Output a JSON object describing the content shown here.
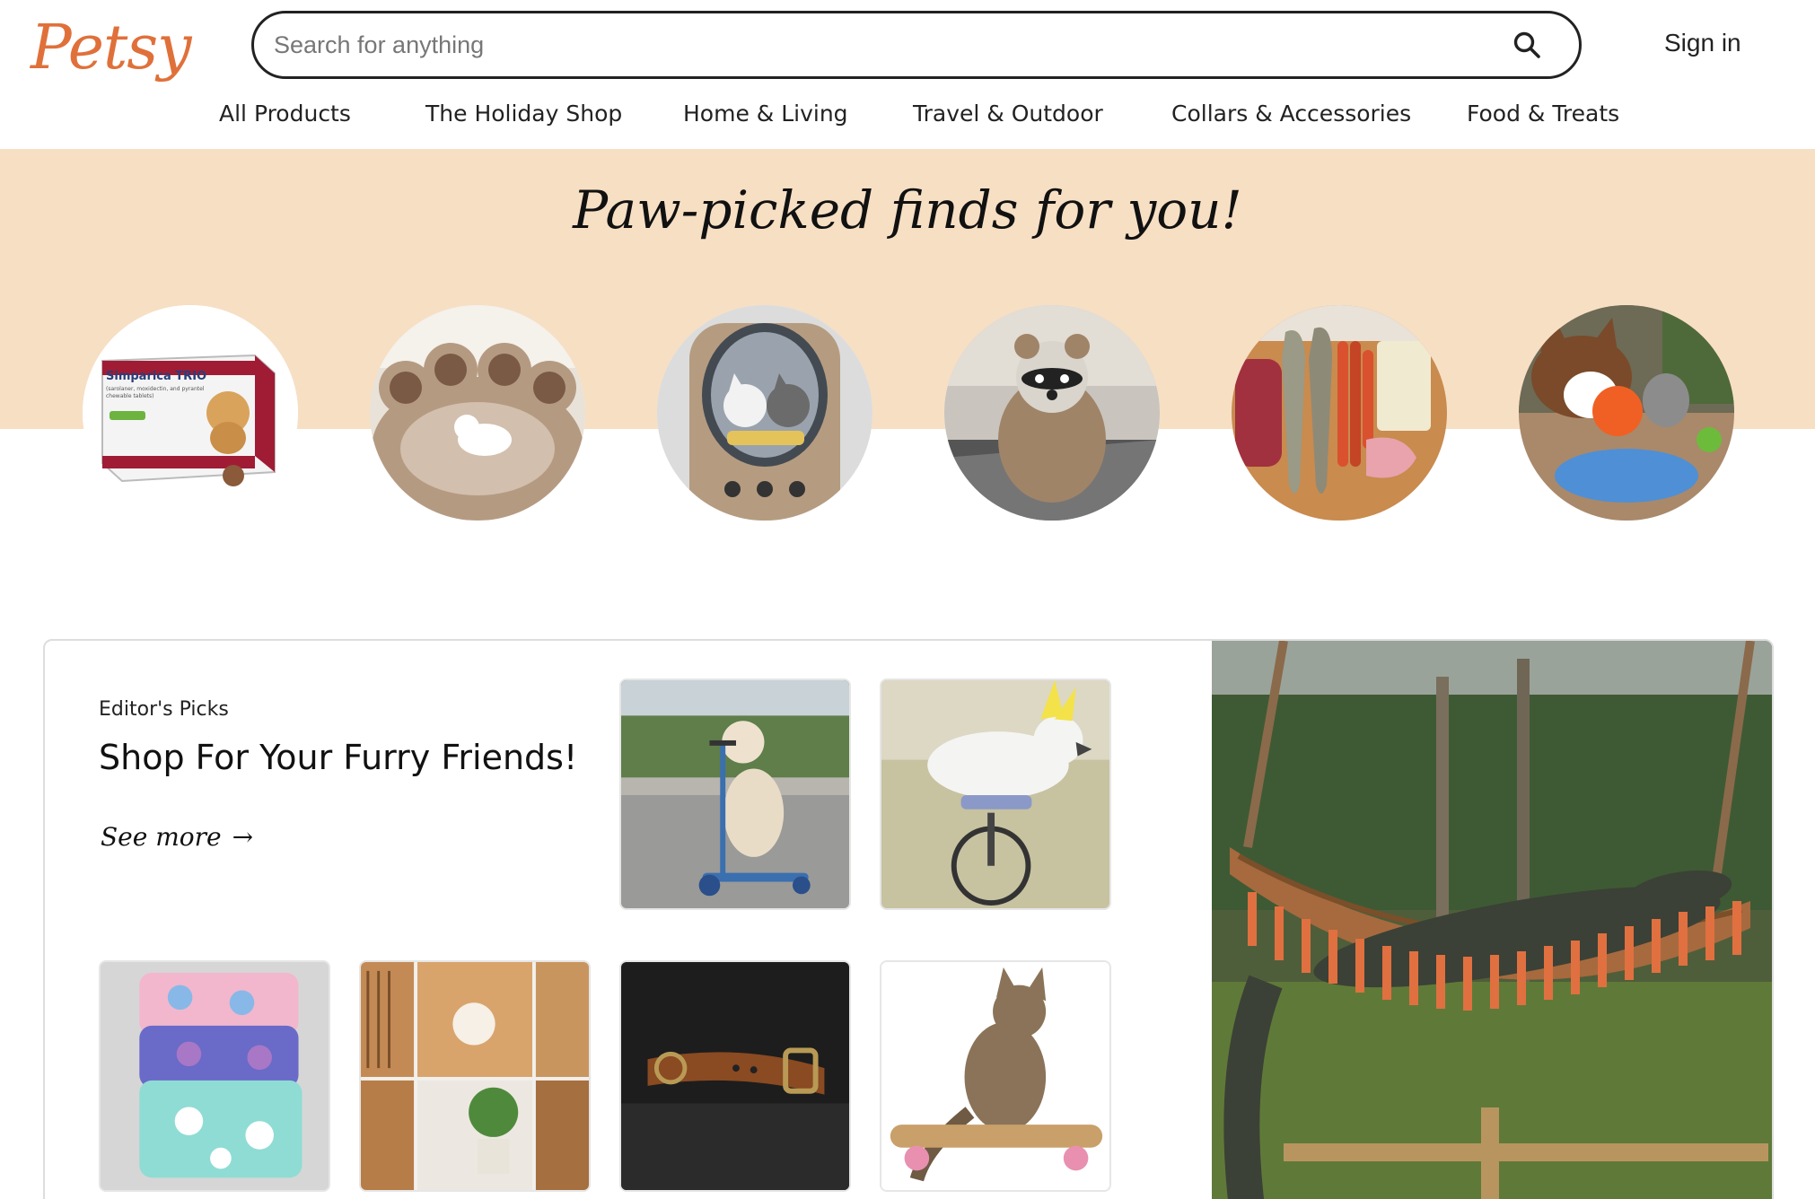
{
  "header": {
    "logo_text": "Petsy",
    "search_placeholder": "Search for anything",
    "sign_in_label": "Sign in",
    "accent_color": "#e0703a"
  },
  "nav": {
    "items": [
      "All Products",
      "The Holiday Shop",
      "Home & Living",
      "Travel & Outdoor",
      "Collars & Accessories",
      "Food & Treats"
    ]
  },
  "hero": {
    "title": "Paw-picked finds for you!",
    "band_color": "#f7dfc4",
    "circles": [
      {
        "name": "product-circle-simparica",
        "label": "Simparica TRIO",
        "box_lines": [
          "(sarolaner, moxidectin, and pyrantel",
          "chewable tablets)"
        ]
      },
      {
        "name": "product-circle-dog-bed"
      },
      {
        "name": "product-circle-cat-carrier"
      },
      {
        "name": "product-circle-raccoon-sweater"
      },
      {
        "name": "product-circle-raw-food"
      },
      {
        "name": "product-circle-dog-toys"
      }
    ]
  },
  "editors_picks": {
    "eyebrow": "Editor's Picks",
    "title": "Shop For Your Furry Friends!",
    "see_more_label": "See more",
    "arrow_glyph": "→",
    "tiles": [
      {
        "name": "pick-dog-scooter"
      },
      {
        "name": "pick-cockatoo-unicycle"
      },
      {
        "name": "pick-fleece-pads"
      },
      {
        "name": "pick-wooden-dog-crates"
      },
      {
        "name": "pick-leather-collar"
      },
      {
        "name": "pick-cat-skateboard"
      }
    ],
    "feature": {
      "name": "feature-alligator-hammock"
    }
  }
}
